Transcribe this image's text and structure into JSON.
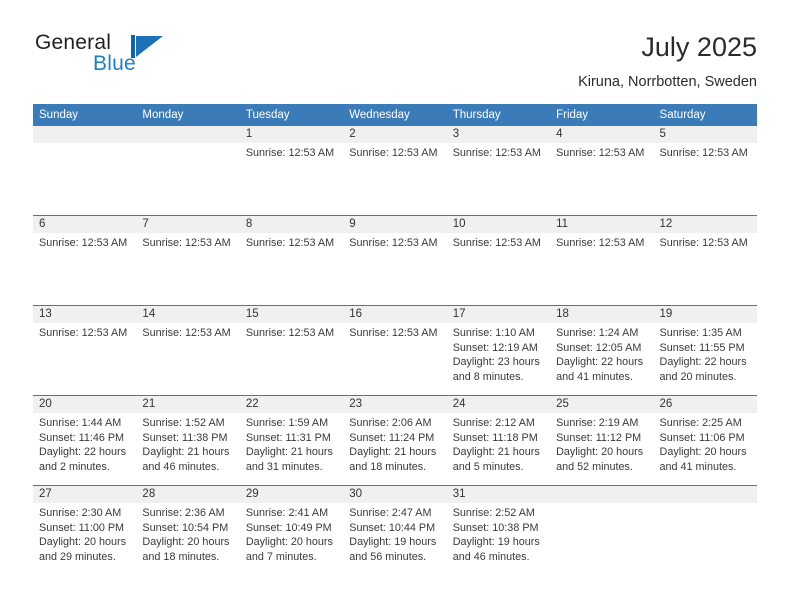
{
  "brand": {
    "name_part1": "General",
    "name_part2": "Blue",
    "accent_color": "#1c71b8"
  },
  "header": {
    "title": "July 2025",
    "subtitle": "Kiruna, Norrbotten, Sweden"
  },
  "calendar": {
    "header_color": "#3b7cb8",
    "weekdays": [
      "Sunday",
      "Monday",
      "Tuesday",
      "Wednesday",
      "Thursday",
      "Friday",
      "Saturday"
    ],
    "weeks": [
      [
        {
          "day": "",
          "lines": []
        },
        {
          "day": "",
          "lines": []
        },
        {
          "day": "1",
          "lines": [
            "Sunrise: 12:53 AM"
          ]
        },
        {
          "day": "2",
          "lines": [
            "Sunrise: 12:53 AM"
          ]
        },
        {
          "day": "3",
          "lines": [
            "Sunrise: 12:53 AM"
          ]
        },
        {
          "day": "4",
          "lines": [
            "Sunrise: 12:53 AM"
          ]
        },
        {
          "day": "5",
          "lines": [
            "Sunrise: 12:53 AM"
          ]
        }
      ],
      [
        {
          "day": "6",
          "lines": [
            "Sunrise: 12:53 AM"
          ]
        },
        {
          "day": "7",
          "lines": [
            "Sunrise: 12:53 AM"
          ]
        },
        {
          "day": "8",
          "lines": [
            "Sunrise: 12:53 AM"
          ]
        },
        {
          "day": "9",
          "lines": [
            "Sunrise: 12:53 AM"
          ]
        },
        {
          "day": "10",
          "lines": [
            "Sunrise: 12:53 AM"
          ]
        },
        {
          "day": "11",
          "lines": [
            "Sunrise: 12:53 AM"
          ]
        },
        {
          "day": "12",
          "lines": [
            "Sunrise: 12:53 AM"
          ]
        }
      ],
      [
        {
          "day": "13",
          "lines": [
            "Sunrise: 12:53 AM"
          ]
        },
        {
          "day": "14",
          "lines": [
            "Sunrise: 12:53 AM"
          ]
        },
        {
          "day": "15",
          "lines": [
            "Sunrise: 12:53 AM"
          ]
        },
        {
          "day": "16",
          "lines": [
            "Sunrise: 12:53 AM"
          ]
        },
        {
          "day": "17",
          "lines": [
            "Sunrise: 1:10 AM",
            "Sunset: 12:19 AM",
            "Daylight: 23 hours",
            "and 8 minutes."
          ]
        },
        {
          "day": "18",
          "lines": [
            "Sunrise: 1:24 AM",
            "Sunset: 12:05 AM",
            "Daylight: 22 hours",
            "and 41 minutes."
          ]
        },
        {
          "day": "19",
          "lines": [
            "Sunrise: 1:35 AM",
            "Sunset: 11:55 PM",
            "Daylight: 22 hours",
            "and 20 minutes."
          ]
        }
      ],
      [
        {
          "day": "20",
          "lines": [
            "Sunrise: 1:44 AM",
            "Sunset: 11:46 PM",
            "Daylight: 22 hours",
            "and 2 minutes."
          ]
        },
        {
          "day": "21",
          "lines": [
            "Sunrise: 1:52 AM",
            "Sunset: 11:38 PM",
            "Daylight: 21 hours",
            "and 46 minutes."
          ]
        },
        {
          "day": "22",
          "lines": [
            "Sunrise: 1:59 AM",
            "Sunset: 11:31 PM",
            "Daylight: 21 hours",
            "and 31 minutes."
          ]
        },
        {
          "day": "23",
          "lines": [
            "Sunrise: 2:06 AM",
            "Sunset: 11:24 PM",
            "Daylight: 21 hours",
            "and 18 minutes."
          ]
        },
        {
          "day": "24",
          "lines": [
            "Sunrise: 2:12 AM",
            "Sunset: 11:18 PM",
            "Daylight: 21 hours",
            "and 5 minutes."
          ]
        },
        {
          "day": "25",
          "lines": [
            "Sunrise: 2:19 AM",
            "Sunset: 11:12 PM",
            "Daylight: 20 hours",
            "and 52 minutes."
          ]
        },
        {
          "day": "26",
          "lines": [
            "Sunrise: 2:25 AM",
            "Sunset: 11:06 PM",
            "Daylight: 20 hours",
            "and 41 minutes."
          ]
        }
      ],
      [
        {
          "day": "27",
          "lines": [
            "Sunrise: 2:30 AM",
            "Sunset: 11:00 PM",
            "Daylight: 20 hours",
            "and 29 minutes."
          ]
        },
        {
          "day": "28",
          "lines": [
            "Sunrise: 2:36 AM",
            "Sunset: 10:54 PM",
            "Daylight: 20 hours",
            "and 18 minutes."
          ]
        },
        {
          "day": "29",
          "lines": [
            "Sunrise: 2:41 AM",
            "Sunset: 10:49 PM",
            "Daylight: 20 hours",
            "and 7 minutes."
          ]
        },
        {
          "day": "30",
          "lines": [
            "Sunrise: 2:47 AM",
            "Sunset: 10:44 PM",
            "Daylight: 19 hours",
            "and 56 minutes."
          ]
        },
        {
          "day": "31",
          "lines": [
            "Sunrise: 2:52 AM",
            "Sunset: 10:38 PM",
            "Daylight: 19 hours",
            "and 46 minutes."
          ]
        },
        {
          "day": "",
          "lines": []
        },
        {
          "day": "",
          "lines": []
        }
      ]
    ]
  }
}
